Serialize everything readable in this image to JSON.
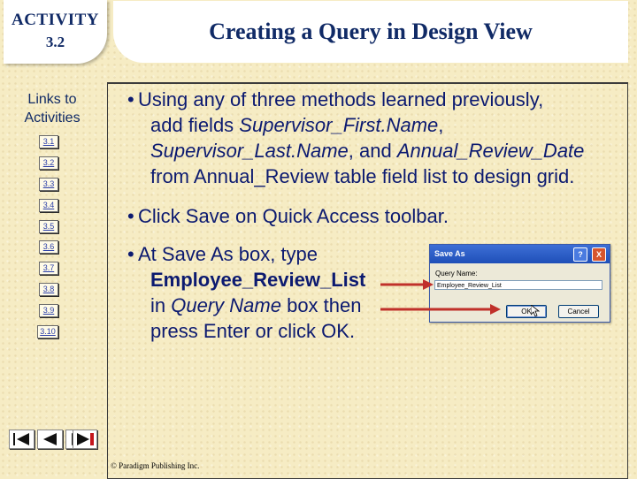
{
  "badge": {
    "line1": "ACTIVITY",
    "line2": "3.2"
  },
  "title": "Creating a Query in Design View",
  "sidebar": {
    "heading": "Links to Activities",
    "links": [
      "3.1",
      "3.2",
      "3.3",
      "3.4",
      "3.5",
      "3.6",
      "3.7",
      "3.8",
      "3.9",
      "3.10"
    ]
  },
  "nav_buttons": [
    "first-icon",
    "previous-icon",
    "next-icon",
    "last-icon"
  ],
  "bullets": {
    "b1": {
      "first_line": "Using any of three methods learned previously,",
      "seg1": "add fields ",
      "field1": "Supervisor_First.Name",
      "seg2": ",",
      "field2": "Supervisor_Last.Name",
      "seg3": ", and ",
      "field3": "Annual_Review_Date",
      "seg4": "from Annual_Review table field list to design grid."
    },
    "b2": {
      "text": "Click Save on Quick Access toolbar."
    },
    "b3": {
      "line1": "At Save As box, type",
      "bold": "Employee_Review_List",
      "in_text": "in ",
      "italic": "Query Name",
      "after": " box then",
      "last": "press Enter or click OK."
    }
  },
  "dialog": {
    "title": "Save As",
    "help": "?",
    "close": "X",
    "label": "Query Name:",
    "value": "Employee_Review_List",
    "ok": "OK",
    "cancel": "Cancel"
  },
  "colors": {
    "text": "#0c1a70",
    "arrow": "#c0302a",
    "background": "#f6ecc4"
  },
  "copyright": "© Paradigm Publishing Inc."
}
